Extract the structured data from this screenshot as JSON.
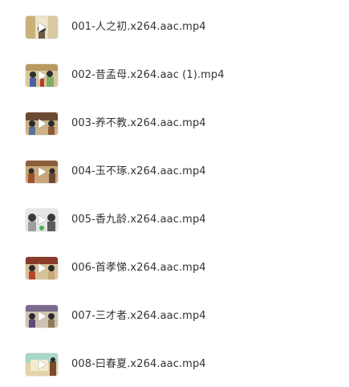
{
  "files": [
    {
      "name": "001-人之初.x264.aac.mp4",
      "icon": "video-thumbnail-icon"
    },
    {
      "name": "002-昔孟母.x264.aac (1).mp4",
      "icon": "video-thumbnail-icon"
    },
    {
      "name": "003-养不教.x264.aac.mp4",
      "icon": "video-thumbnail-icon"
    },
    {
      "name": "004-玉不琢.x264.aac.mp4",
      "icon": "video-thumbnail-icon"
    },
    {
      "name": "005-香九龄.x264.aac.mp4",
      "icon": "video-thumbnail-icon"
    },
    {
      "name": "006-首孝悌.x264.aac.mp4",
      "icon": "video-thumbnail-icon"
    },
    {
      "name": "007-三才者.x264.aac.mp4",
      "icon": "video-thumbnail-icon"
    },
    {
      "name": "008-曰春夏.x264.aac.mp4",
      "icon": "video-thumbnail-icon"
    }
  ],
  "colors": {
    "text": "#333333",
    "background": "#ffffff",
    "play_overlay": "#ffffff"
  }
}
